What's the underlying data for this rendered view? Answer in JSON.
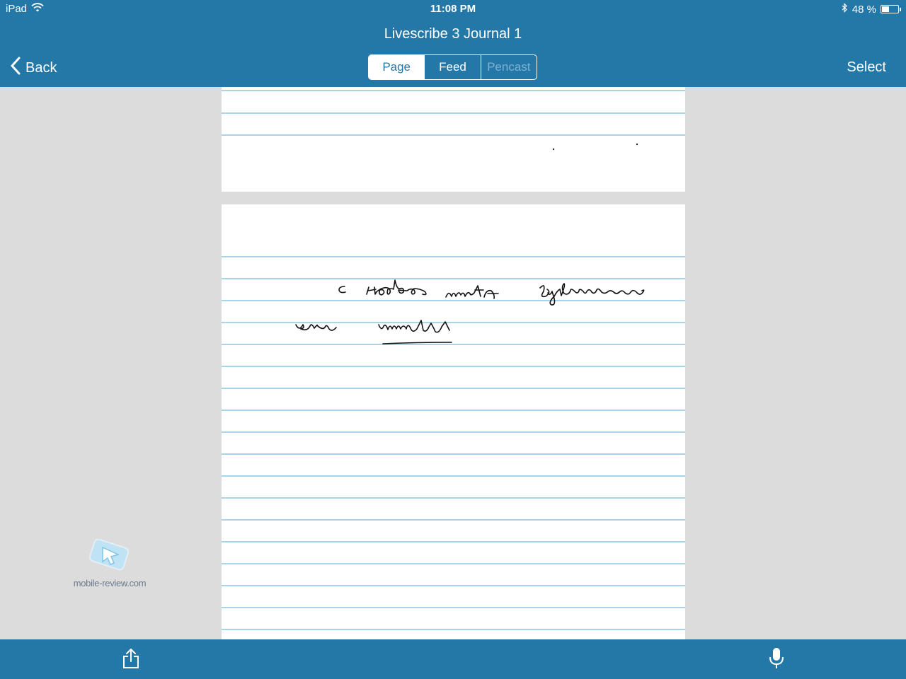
{
  "status_bar": {
    "device": "iPad",
    "time": "11:08 PM",
    "battery_text": "48 %",
    "battery_level": 0.48
  },
  "nav": {
    "title": "Livescribe 3 Journal 1",
    "back_label": "Back",
    "select_label": "Select",
    "segments": [
      {
        "label": "Page",
        "state": "active"
      },
      {
        "label": "Feed",
        "state": "inactive"
      },
      {
        "label": "Pencast",
        "state": "disabled"
      }
    ]
  },
  "watermark": {
    "text": "mobile-review.com"
  },
  "icons": {
    "back": "chevron-left-icon",
    "share": "share-icon",
    "mic": "microphone-icon",
    "wifi": "wifi-icon",
    "bluetooth": "bluetooth-icon",
    "battery": "battery-icon"
  },
  "colors": {
    "accent": "#2478a8",
    "rule_line": "#a7d4e6",
    "background": "#dcdcdc"
  }
}
